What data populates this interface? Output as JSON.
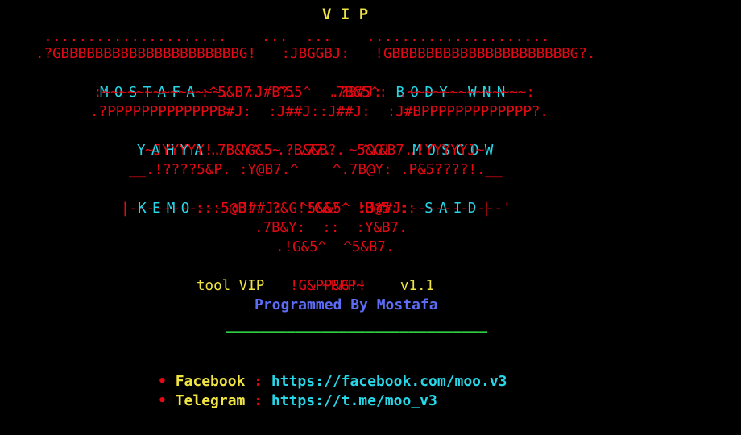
{
  "title": "V I P",
  "art": {
    "dots": ".....................    ...  ...    .....................",
    "l2": ".?GBBBBBBBBBBBBBBBBBBBBBG!   :JBGGBJ:   !GBBBBBBBBBBBBBBBBBBBBBG?.",
    "l3_name1": "MOSTAFA",
    "l3_mid": ":^5&B7.  ^55^  .7B&5^:",
    "l3_name2": "BODY WNN",
    "l4": ":~~~~~~~~~~~~~~.  :J#B?.    .?B#J:  .~~~~~~~~~~~~~~:",
    "l5": ".?PPPPPPPPPPPPPB#J:  :J##J::J##J:  :J#BPPPPPPPPPPPPP?.",
    "l6_name1": "YAHYA",
    "l6_mid": ".7B&Y^  .?B&&B?.  ^Y&B7.",
    "l6_name2": "MOSCOW",
    "l7": "~JYYYYY!.  !G&5~  .77.  ~5&G!  .!YYYYYJ~",
    "l8": "__.!????5&P. :Y@B7.^    ^.7B@Y: .P&5????!.__",
    "l9_pipe": "|",
    "l9_name1": "KEMO",
    "l9_mid": ":::5@B!  ?&G!!G&?  !B@5:::",
    "l9_name2": "SAID",
    "l9_end": "|",
    "l10": "'------------:J##J:  ^5&&5^ :J##J:-----------'",
    "l11": ".7B&Y:  ::  :Y&B7.",
    "l12": ".!G&5^  ^5&B7.",
    "l13_tool": "tool VIP",
    "l13_mid": "!G&PP&G!!",
    "l13_ver": "v1.1",
    "l14": "~PPP~"
  },
  "programmed_by": "Programmed By Mostafa",
  "rule": "______________________________",
  "links": [
    {
      "bullet": "•",
      "label": "Facebook",
      "sep": ":",
      "url": "https://facebook.com/moo.v3"
    },
    {
      "bullet": "•",
      "label": "Telegram",
      "sep": ":",
      "url": "https://t.me/moo_v3"
    }
  ]
}
